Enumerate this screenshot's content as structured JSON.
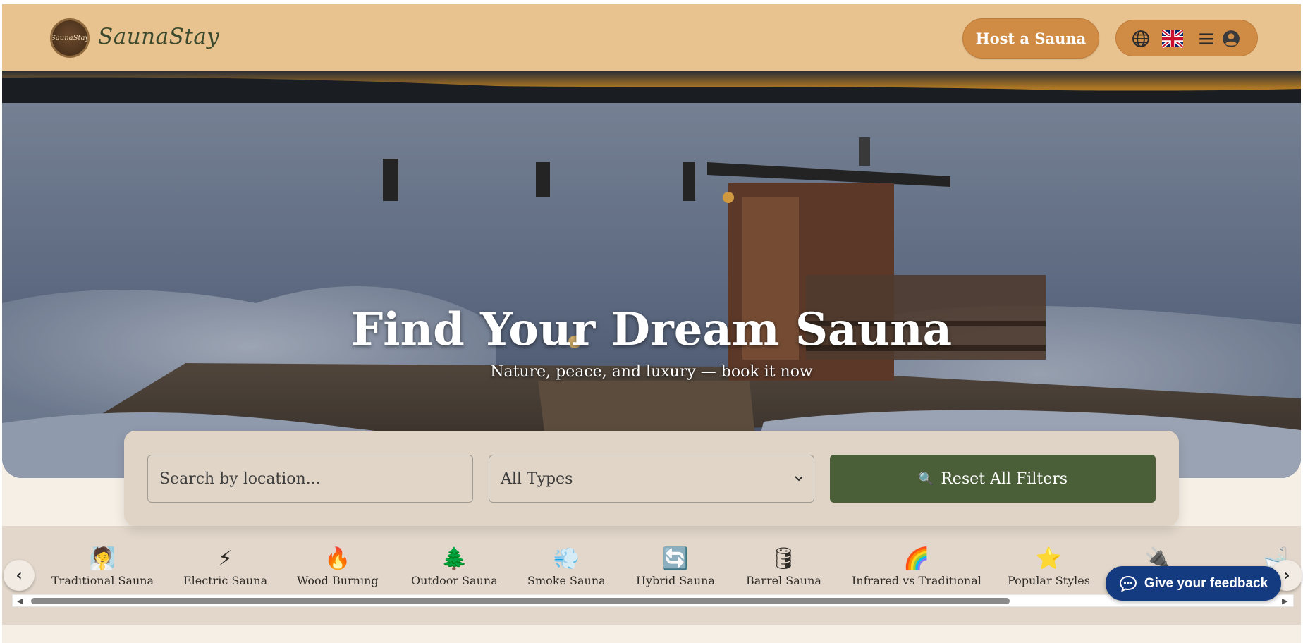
{
  "brand": {
    "logo_text": "SaunaStay",
    "name": "SaunaStay"
  },
  "header": {
    "host_label": "Host a Sauna",
    "icons": [
      "globe-icon",
      "uk-flag-icon",
      "hamburger-menu-icon",
      "user-account-icon"
    ]
  },
  "hero": {
    "title": "Find Your Dream Sauna",
    "subtitle": "Nature, peace, and luxury — book it now"
  },
  "search": {
    "location_placeholder": "Search by location...",
    "type_selected": "All Types",
    "reset_label": "Reset All Filters",
    "reset_icon": "🔍"
  },
  "categories": [
    {
      "emoji": "🧖",
      "label": "Traditional Sauna",
      "icon": "sauna-person-icon"
    },
    {
      "emoji": "⚡",
      "label": "Electric Sauna",
      "icon": "lightning-icon"
    },
    {
      "emoji": "🔥",
      "label": "Wood Burning",
      "icon": "fire-icon"
    },
    {
      "emoji": "🌲",
      "label": "Outdoor Sauna",
      "icon": "tree-icon"
    },
    {
      "emoji": "💨",
      "label": "Smoke Sauna",
      "icon": "smoke-icon"
    },
    {
      "emoji": "🔄",
      "label": "Hybrid Sauna",
      "icon": "cycle-icon"
    },
    {
      "emoji": "🛢",
      "label": "Barrel Sauna",
      "icon": "barrel-icon"
    },
    {
      "emoji": "🌈",
      "label": "Infrared vs Traditional",
      "icon": "rainbow-icon"
    },
    {
      "emoji": "⭐",
      "label": "Popular Styles",
      "icon": "star-icon"
    },
    {
      "emoji": "🔌",
      "label": "",
      "icon": "plug-icon"
    },
    {
      "emoji": "🛁",
      "label": "",
      "icon": "bathtub-icon"
    }
  ],
  "feedback": {
    "label": "Give your feedback"
  },
  "colors": {
    "header_bg": "#e8c390",
    "accent_orange": "#d08c45",
    "reset_green": "#4a5f37",
    "feedback_blue": "#143a80",
    "panel_bg": "#e0d4c6"
  }
}
